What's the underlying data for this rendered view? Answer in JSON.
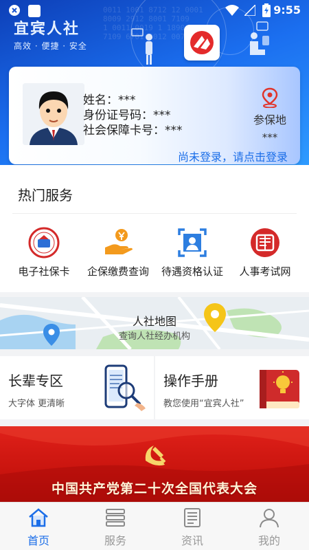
{
  "status_bar": {
    "time": "9:55"
  },
  "header": {
    "brand_title": "宜宾人社",
    "slogan": "高效 · 便捷 · 安全"
  },
  "profile": {
    "name_line": "姓名：***",
    "id_line": "身份证号码：***",
    "ss_card_line": "社会保障卡号：***",
    "insured_place_label": "参保地",
    "insured_place_value": "***",
    "login_prompt": "尚未登录，请点击登录"
  },
  "hot_services": {
    "title": "热门服务",
    "items": [
      {
        "label": "电子社保卡",
        "icon": "social-security-card-icon"
      },
      {
        "label": "企保缴费查询",
        "icon": "payment-hand-icon"
      },
      {
        "label": "待遇资格认证",
        "icon": "face-recognition-icon"
      },
      {
        "label": "人事考试网",
        "icon": "exam-seal-icon"
      }
    ]
  },
  "map": {
    "title": "人社地图",
    "subtitle": "查询人社经办机构"
  },
  "tiles": {
    "elder": {
      "title": "长辈专区",
      "subtitle": "大字体 更清晰"
    },
    "manual": {
      "title": "操作手册",
      "subtitle": "教您使用“宜宾人社”"
    }
  },
  "banner": {
    "text": "中国共产党第二十次全国代表大会"
  },
  "bottom_nav": [
    {
      "label": "首页",
      "icon": "home-icon",
      "active": true
    },
    {
      "label": "服务",
      "icon": "service-list-icon",
      "active": false
    },
    {
      "label": "资讯",
      "icon": "news-icon",
      "active": false
    },
    {
      "label": "我的",
      "icon": "user-icon",
      "active": false
    }
  ],
  "colors": {
    "primary": "#1b6ee8",
    "header_blue": "#1b6ff0",
    "banner_red": "#d0160f",
    "location_yellow": "#f5c518"
  }
}
